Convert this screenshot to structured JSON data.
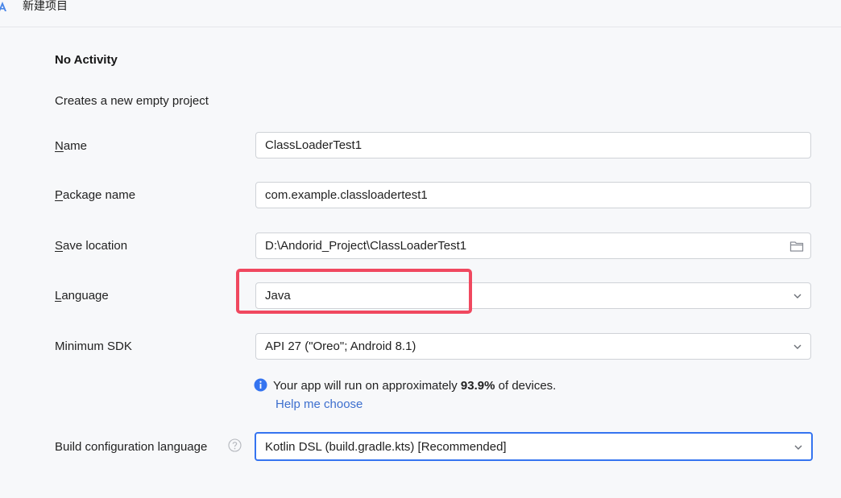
{
  "window": {
    "title": "新建项目"
  },
  "template": {
    "heading": "No Activity",
    "description": "Creates a new empty project"
  },
  "form": {
    "name": {
      "mnemonic": "N",
      "label_rest": "ame",
      "value": "ClassLoaderTest1"
    },
    "package_name": {
      "mnemonic": "P",
      "label_rest": "ackage name",
      "value": "com.example.classloadertest1"
    },
    "save_location": {
      "mnemonic": "S",
      "label_rest": "ave location",
      "value": "D:\\Andorid_Project\\ClassLoaderTest1",
      "icon": "folder-icon"
    },
    "language": {
      "mnemonic": "L",
      "label_rest": "anguage",
      "value": "Java"
    },
    "minimum_sdk": {
      "label": "Minimum SDK",
      "value": "API 27 (\"Oreo\"; Android 8.1)"
    },
    "sdk_info": {
      "text_before": "Your app will run on approximately ",
      "percentage": "93.9%",
      "text_after": " of devices.",
      "help_link": "Help me choose"
    },
    "build_config": {
      "label": "Build configuration language",
      "value": "Kotlin DSL (build.gradle.kts) [Recommended]"
    }
  },
  "colors": {
    "accent": "#3574f0",
    "highlight": "#f0485f",
    "link": "#3d6fce",
    "info": "#3574f0"
  }
}
